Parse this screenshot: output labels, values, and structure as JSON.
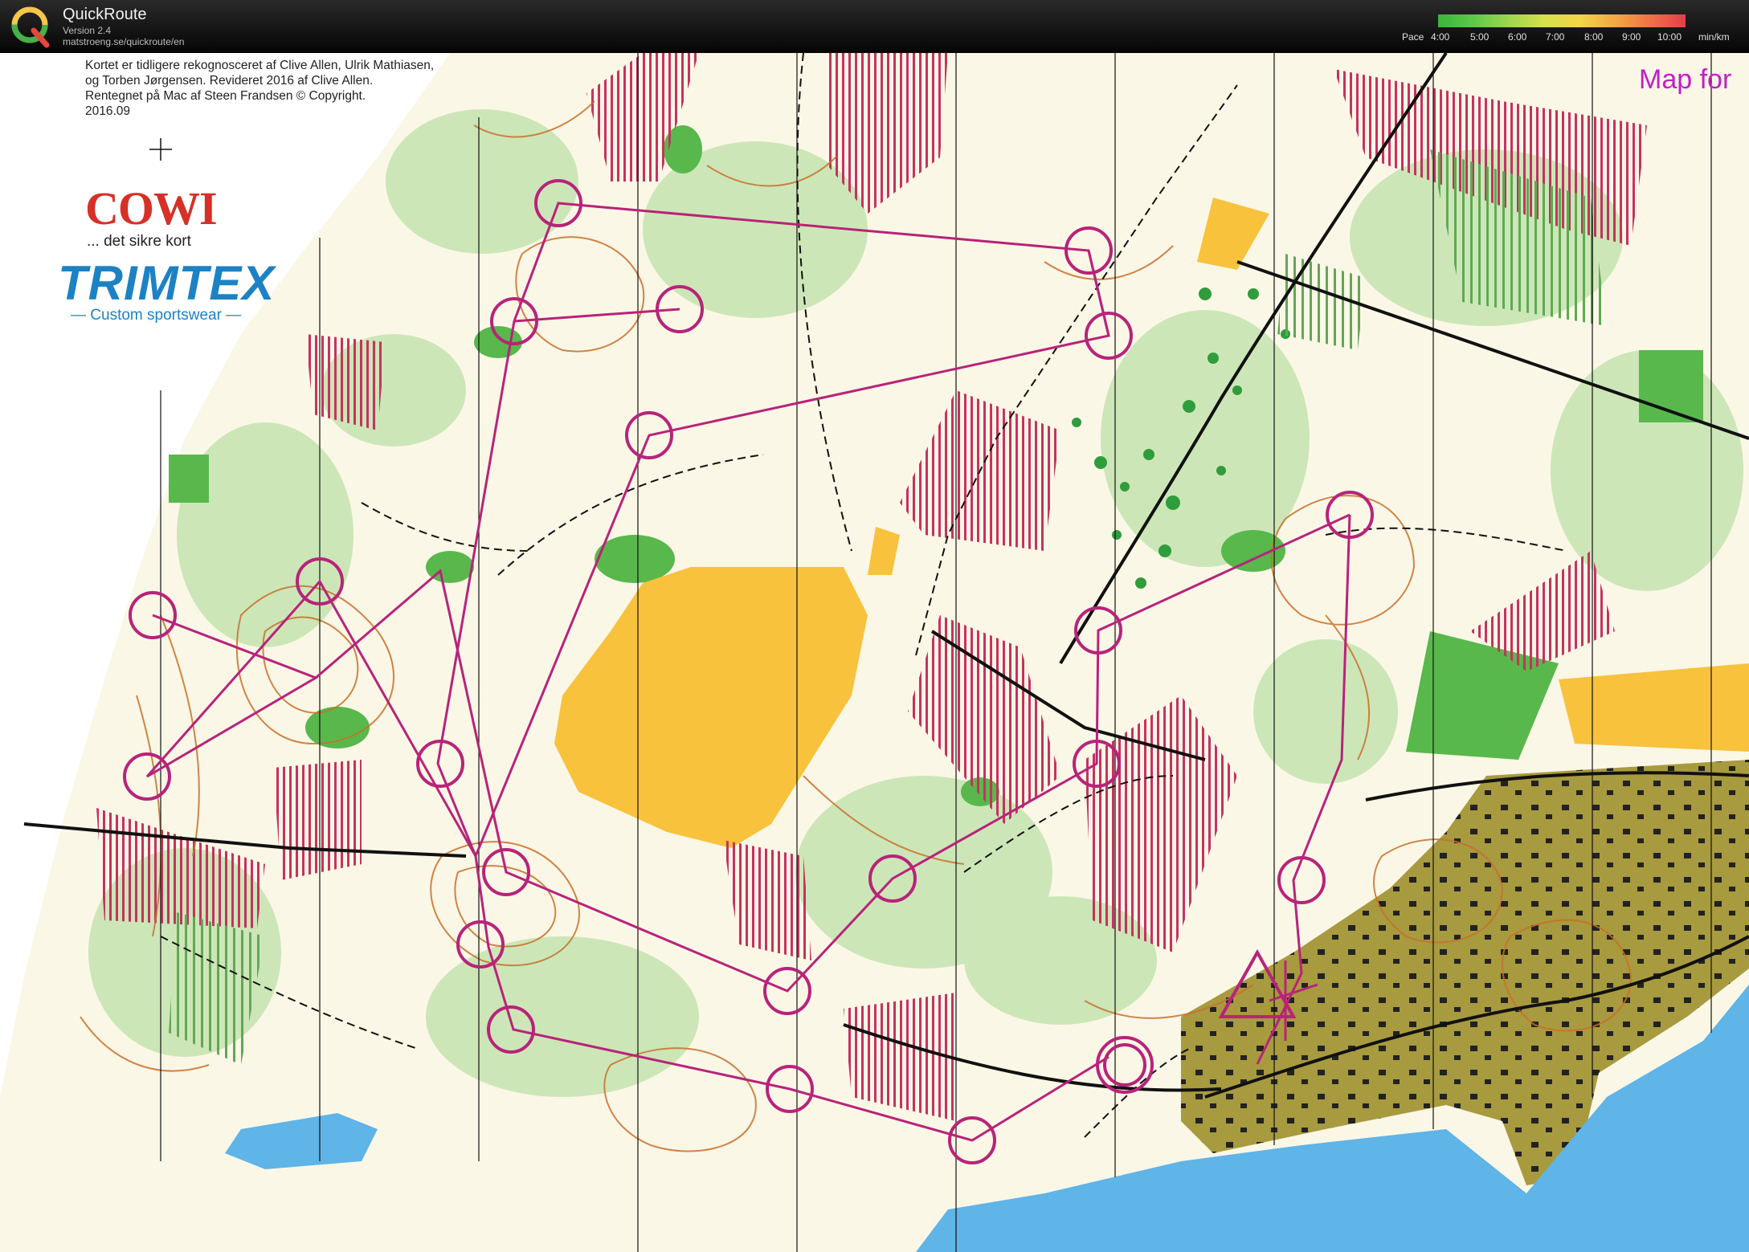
{
  "app": {
    "name": "QuickRoute",
    "version": "Version 2.4",
    "url": "matstroeng.se/quickroute/en",
    "logo_icon": "quickroute-q-logo-icon"
  },
  "pace_legend": {
    "label": "Pace",
    "ticks": [
      "4:00",
      "5:00",
      "6:00",
      "7:00",
      "8:00",
      "9:00",
      "10:00"
    ],
    "unit": "min/km",
    "colors": [
      "#3cb43c",
      "#9cd64e",
      "#d7e04b",
      "#f2d447",
      "#f4a846",
      "#ef7146",
      "#e63e4a"
    ]
  },
  "map": {
    "credits": "Kortet er tidligere rekognosceret af Clive Allen, Ulrik Mathiasen,\nog Torben Jørgensen. Revideret 2016 af Clive Allen.\nRentegnet på Mac af Steen Frandsen   © Copyright.\n2016.09",
    "sponsor1": "COWI",
    "sponsor1_tagline": "... det sikre kort",
    "sponsor2": "TRIMTEX",
    "sponsor2_tagline": "— Custom sportswear —",
    "title_fragment": "Map for",
    "colors": {
      "course": "#b8237a",
      "open_land": "#f8c23c",
      "forest_green": "#58b84c",
      "vegetation_light": "#cde6b8",
      "contour": "#c8702a",
      "water": "#5fb4e8",
      "urban_olive": "#a89a3e",
      "out_of_bounds": "#c4335f"
    }
  }
}
